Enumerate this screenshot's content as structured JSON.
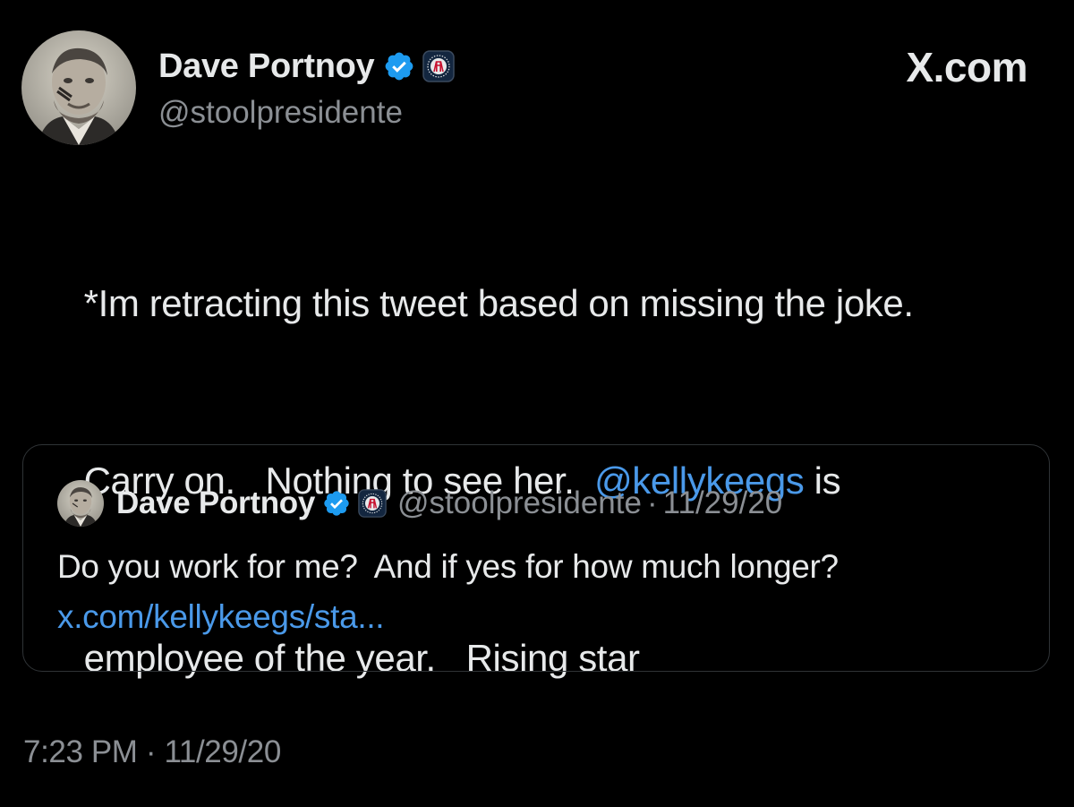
{
  "author": {
    "name": "Dave Portnoy",
    "handle": "@stoolpresidente",
    "verified_icon": "verified-badge-icon",
    "affiliate_icon": "barstool-affiliate-icon"
  },
  "brand": "X.com",
  "tweet": {
    "lines": [
      [
        {
          "text": "*Im retracting this tweet based on missing the joke."
        }
      ],
      [
        {
          "text": "Carry on.   Nothing to see her.  "
        },
        {
          "text": "@kellykeegs",
          "mention": true
        },
        {
          "text": " is"
        }
      ],
      [
        {
          "text": "employee of the year.   Rising star"
        }
      ]
    ],
    "timestamp": "7:23 PM · 11/29/20"
  },
  "quote": {
    "name": "Dave Portnoy",
    "handle": "@stoolpresidente",
    "separator": "·",
    "date": "11/29/20",
    "text": "Do you work for me?  And if yes for how much longer?",
    "link": "x.com/kellykeegs/sta..."
  },
  "colors": {
    "background": "#000000",
    "text": "#e7e9ea",
    "secondary": "#8b8f94",
    "link": "#4a99e9",
    "verified": "#1d9bf0",
    "border": "#2f3336"
  }
}
